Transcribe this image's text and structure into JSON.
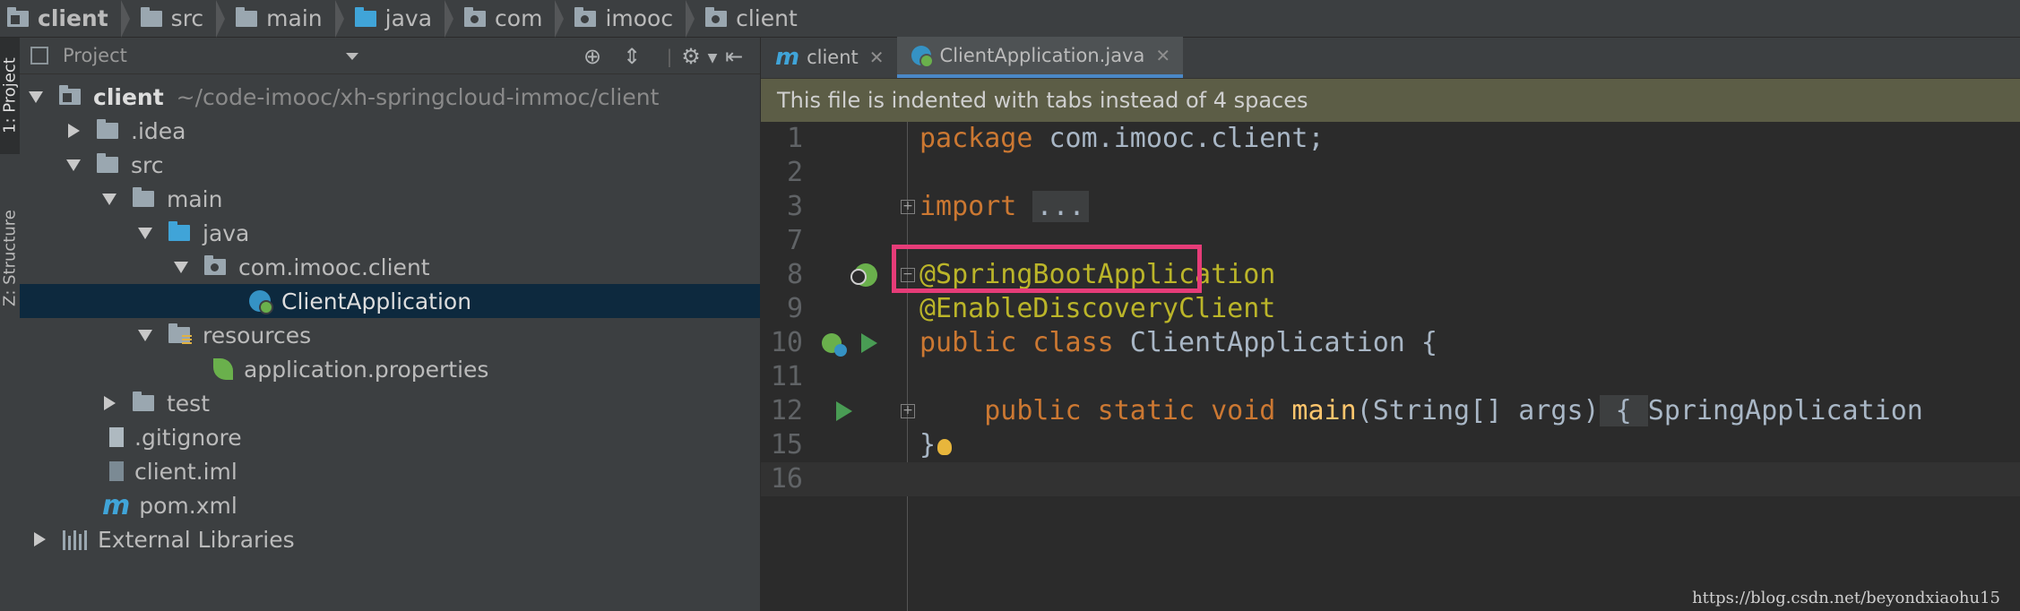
{
  "breadcrumb": [
    "client",
    "src",
    "main",
    "java",
    "com",
    "imooc",
    "client"
  ],
  "toolstrip": {
    "project_tab": "1: Project",
    "structure_tab": "Z: Structure"
  },
  "project_panel": {
    "title": "Project",
    "tree": {
      "root_name": "client",
      "root_path": "~/code-imooc/xh-springcloud-immoc/client",
      "idea": ".idea",
      "src": "src",
      "main": "main",
      "java": "java",
      "package": "com.imooc.client",
      "class": "ClientApplication",
      "resources": "resources",
      "properties": "application.properties",
      "test": "test",
      "gitignore": ".gitignore",
      "iml": "client.iml",
      "pom": "pom.xml",
      "libs": "External Libraries"
    }
  },
  "editor": {
    "tabs": [
      {
        "label": "client",
        "icon": "maven-m-icon"
      },
      {
        "label": "ClientApplication.java",
        "icon": "spring-class-icon"
      }
    ],
    "notice": "This file is indented with tabs instead of 4 spaces",
    "lines": {
      "n1": "1",
      "n2": "2",
      "n3": "3",
      "n7": "7",
      "n8": "8",
      "n9": "9",
      "n10": "10",
      "n11": "11",
      "n12": "12",
      "n15": "15",
      "n16": "16"
    },
    "code": {
      "package_kw": "package",
      "package_name": " com.imooc.client;",
      "import_kw": "import",
      "import_dots": "...",
      "ann1": "@SpringBootApplication",
      "ann2": "@EnableDiscoveryClient",
      "class_kw": "public class",
      "class_name": " ClientApplication {",
      "method_kw": "public static void",
      "method_name": "main",
      "method_args": "(String[] args)",
      "method_brace": " { ",
      "method_body": "SpringApplication",
      "close_brace": "}"
    }
  },
  "watermark": "https://blog.csdn.net/beyondxiaohu15",
  "colors": {
    "keyword": "#cc7832",
    "annotation": "#bbb529",
    "highlight_box": "#e63c78",
    "selection": "#0d293e"
  }
}
